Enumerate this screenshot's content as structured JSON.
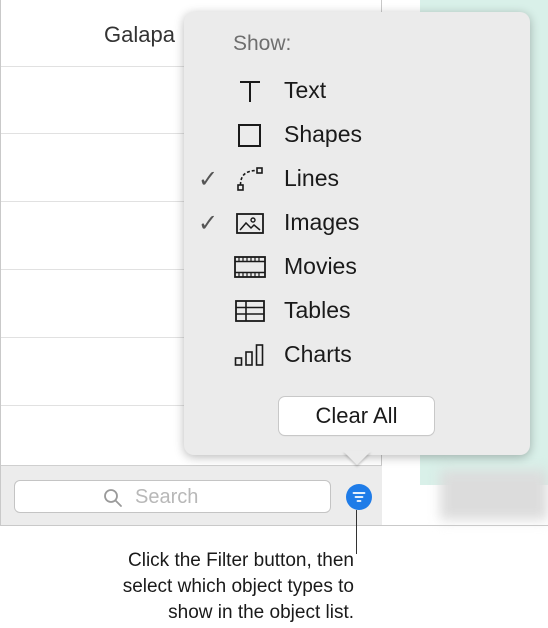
{
  "object_list": {
    "visible_item": "Galapa"
  },
  "search": {
    "placeholder": "Search"
  },
  "popover": {
    "heading": "Show:",
    "items": [
      {
        "label": "Text",
        "icon": "text-icon",
        "checked": false
      },
      {
        "label": "Shapes",
        "icon": "shape-icon",
        "checked": false
      },
      {
        "label": "Lines",
        "icon": "line-icon",
        "checked": true
      },
      {
        "label": "Images",
        "icon": "image-icon",
        "checked": true
      },
      {
        "label": "Movies",
        "icon": "movie-icon",
        "checked": false
      },
      {
        "label": "Tables",
        "icon": "table-icon",
        "checked": false
      },
      {
        "label": "Charts",
        "icon": "chart-icon",
        "checked": false
      }
    ],
    "check_glyph": "✓",
    "clear_label": "Clear All"
  },
  "callout": {
    "lines": [
      "Click the Filter button, then",
      "select which object types to",
      "show in the object list."
    ]
  },
  "colors": {
    "accent": "#1f7ce8",
    "canvas": "#d9f0e9"
  }
}
